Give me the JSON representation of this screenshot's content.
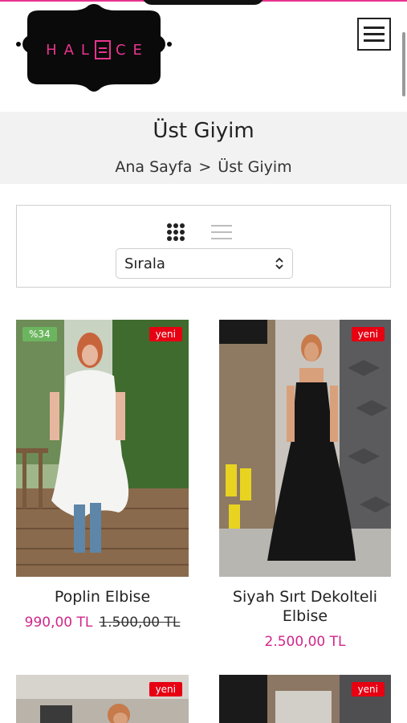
{
  "brand": {
    "logo_text_left": "HAL",
    "logo_text_right": "CE"
  },
  "header": {
    "menu_icon": "hamburger-icon"
  },
  "page": {
    "title": "Üst Giyim"
  },
  "breadcrumb": {
    "home": "Ana Sayfa",
    "separator": ">",
    "current": "Üst Giyim"
  },
  "toolbar": {
    "grid_view_icon": "grid-icon",
    "list_view_icon": "list-icon",
    "sort_label": "Sırala"
  },
  "colors": {
    "brand_pink": "#e8348f",
    "price": "#d0268b",
    "badge_new": "#e60012",
    "badge_discount": "#6cb55f"
  },
  "products": [
    {
      "name": "Poplin Elbise",
      "price": "990,00 TL",
      "old_price": "1.500,00 TL",
      "discount": "%34",
      "badge": "yeni"
    },
    {
      "name": "Siyah Sırt Dekolteli Elbise",
      "price": "2.500,00 TL",
      "badge": "yeni"
    },
    {
      "badge": "yeni"
    },
    {
      "badge": "yeni"
    }
  ]
}
